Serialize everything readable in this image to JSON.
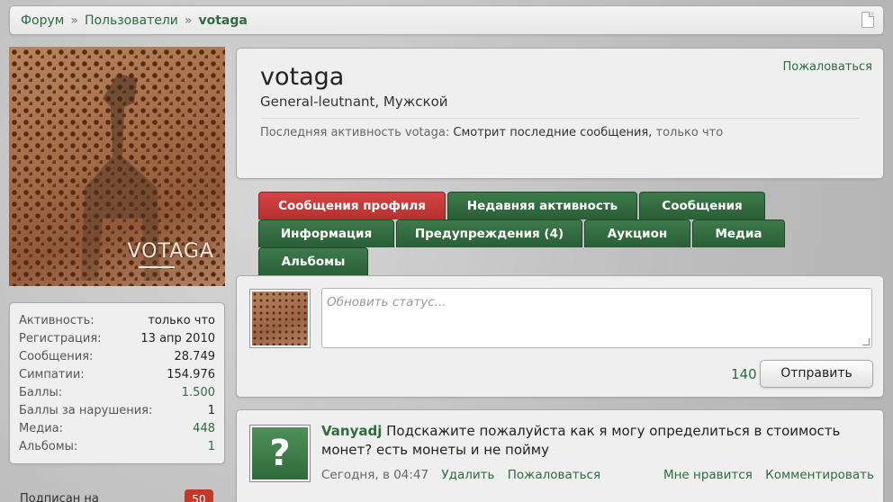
{
  "breadcrumb": {
    "items": [
      "Форум",
      "Пользователи"
    ],
    "separator": "»",
    "current": "votaga"
  },
  "avatar": {
    "watermark": "VOTAGA"
  },
  "stats": [
    {
      "label": "Активность:",
      "value": "только что"
    },
    {
      "label": "Регистрация:",
      "value": "13 апр 2010"
    },
    {
      "label": "Сообщения:",
      "value": "28.749"
    },
    {
      "label": "Симпатии:",
      "value": "154.976"
    },
    {
      "label": "Баллы:",
      "value": "1.500"
    },
    {
      "label": "Баллы за нарушения:",
      "value": "1"
    },
    {
      "label": "Медиа:",
      "value": "448"
    },
    {
      "label": "Альбомы:",
      "value": "1"
    }
  ],
  "subscribed": {
    "label": "Подписан на",
    "count": "50"
  },
  "profile": {
    "username": "votaga",
    "title": "General-leutnant, Мужской",
    "report_label": "Пожаловаться",
    "activity_prefix": "Последняя активность votaga:",
    "activity_text": "Смотрит последние сообщения,",
    "activity_time": "только что"
  },
  "tabs": {
    "profile_posts": "Сообщения профиля",
    "recent_activity": "Недавняя активность",
    "posts": "Сообщения",
    "info": "Информация",
    "warnings": "Предупреждения (4)",
    "auction": "Аукцион",
    "media": "Медиа",
    "albums": "Альбомы"
  },
  "status": {
    "placeholder": "Обновить статус...",
    "counter": "140",
    "send_label": "Отправить"
  },
  "post": {
    "author": "Vanyadj",
    "text": "Подскажите пожалуйста как я могу определиться в стоимость монет? есть монеты и не пойму",
    "time": "Сегодня, в 04:47",
    "delete_label": "Удалить",
    "report_label": "Пожаловаться",
    "like_label": "Мне нравится",
    "comment_label": "Комментировать",
    "avatar_glyph": "?"
  },
  "colors": {
    "accent_green": "#2e6b3f",
    "active_tab_red": "#c93b3b",
    "tab_green": "#2f6b3d",
    "badge_red": "#c0392b"
  }
}
